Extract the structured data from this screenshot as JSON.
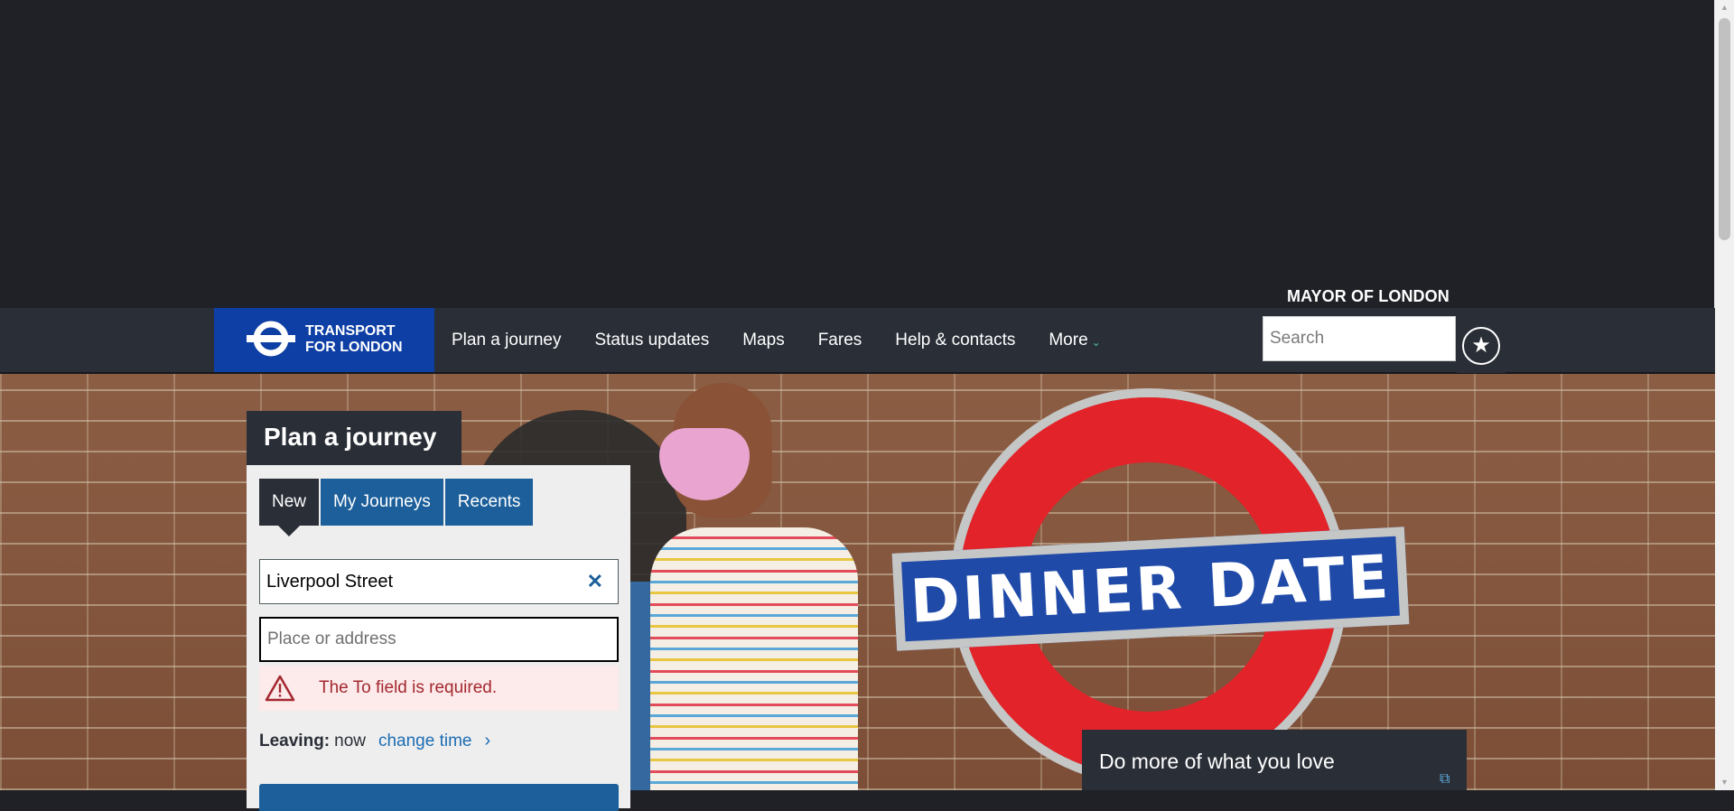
{
  "header": {
    "mayor_label": "MAYOR OF LONDON",
    "logo_line1": "TRANSPORT",
    "logo_line2": "FOR LONDON",
    "nav": [
      "Plan a journey",
      "Status updates",
      "Maps",
      "Fares",
      "Help & contacts"
    ],
    "more_label": "More",
    "search_placeholder": "Search"
  },
  "hero": {
    "sign_text": "DINNER DATE",
    "promo_text": "Do more of what you love"
  },
  "journey_planner": {
    "title": "Plan a journey",
    "tabs": [
      "New",
      "My Journeys",
      "Recents"
    ],
    "active_tab": "New",
    "from_value": "Liverpool Street",
    "to_placeholder": "Place or address",
    "error_message": "The To field is required.",
    "leaving_label": "Leaving:",
    "leaving_value": "now",
    "change_time_label": "change time"
  },
  "colors": {
    "brand_blue": "#0e3fa5",
    "header_dark": "#2a2e37",
    "tab_blue": "#1c5f9a",
    "error_red": "#a3282f"
  },
  "icons": [
    "roundel-logo-icon",
    "chevron-down-icon",
    "star-icon",
    "close-icon",
    "warning-icon",
    "chevron-right-icon",
    "external-link-icon"
  ]
}
